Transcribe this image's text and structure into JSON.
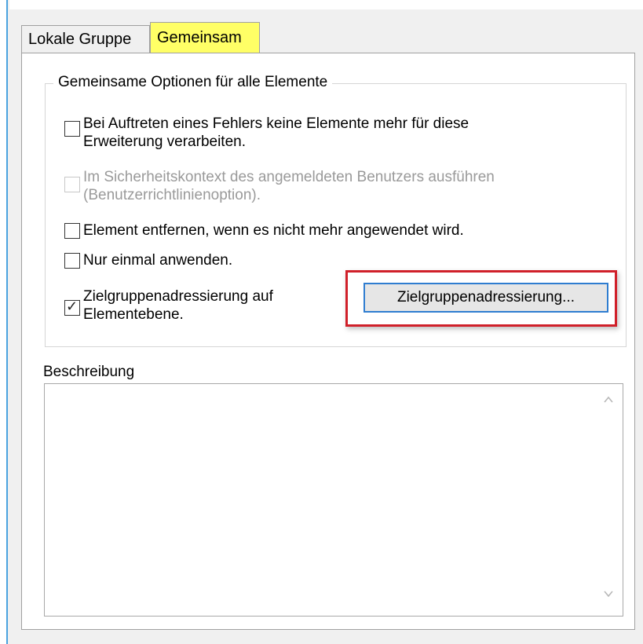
{
  "tabs": [
    {
      "label": "Lokale Gruppe",
      "active": false
    },
    {
      "label": "Gemeinsam",
      "active": true
    }
  ],
  "group": {
    "title": "Gemeinsame Optionen für alle Elemente",
    "options": [
      {
        "line1": "Bei Auftreten eines Fehlers keine Elemente mehr für diese",
        "line2": "Erweiterung verarbeiten.",
        "checked": false,
        "enabled": true
      },
      {
        "line1": "Im Sicherheitskontext des angemeldeten Benutzers ausführen",
        "line2": "(Benutzerrichtlinienoption).",
        "checked": false,
        "enabled": false
      },
      {
        "line1": "Element entfernen, wenn es nicht mehr angewendet wird.",
        "checked": false,
        "enabled": true
      },
      {
        "line1": "Nur einmal anwenden.",
        "checked": false,
        "enabled": true
      },
      {
        "line1": "Zielgruppenadressierung auf",
        "line2": "Elementebene.",
        "checked": true,
        "enabled": true
      }
    ],
    "targeting_button": "Zielgruppenadressierung..."
  },
  "description": {
    "label": "Beschreibung",
    "value": ""
  },
  "colors": {
    "active_tab_highlight": "#ffff66",
    "annotation_border": "#d0202a",
    "button_focus_border": "#2f7dd0"
  },
  "icons": {
    "check": "checkmark-icon",
    "scroll_up": "chevron-up-icon",
    "scroll_down": "chevron-down-icon"
  }
}
